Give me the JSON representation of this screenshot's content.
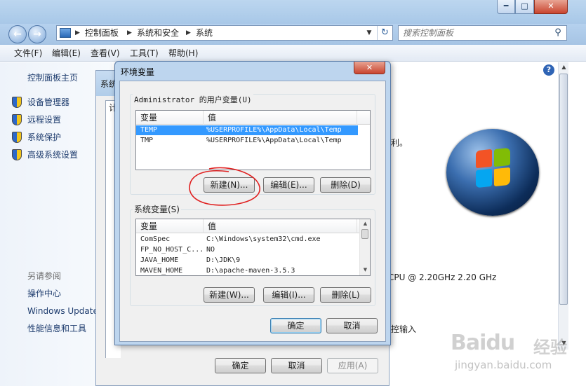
{
  "explorer": {
    "breadcrumbs": [
      "控制面板",
      "系统和安全",
      "系统"
    ],
    "search_placeholder": "搜索控制面板",
    "menu": [
      "文件(F)",
      "编辑(E)",
      "查看(V)",
      "工具(T)",
      "帮助(H)"
    ],
    "sidebar": {
      "home": "控制面板主页",
      "items": [
        "设备管理器",
        "远程设置",
        "系统保护",
        "高级系统设置"
      ],
      "see_also_heading": "另请参阅",
      "see_also": [
        "操作中心",
        "Windows Update",
        "性能信息和工具"
      ]
    },
    "right_fragments": {
      "rights": "利。",
      "cpu": "CPU @ 2.20GHz   2.20 GHz",
      "touch": "控输入"
    }
  },
  "system_properties": {
    "title_fragment": "系统",
    "tab_fragment": "计",
    "ok": "确定",
    "cancel": "取消",
    "apply": "应用(A)"
  },
  "env_dialog": {
    "title": "环境变量",
    "user_group_label": "Administrator 的用户变量(U)",
    "columns": [
      "变量",
      "值"
    ],
    "user_vars": [
      {
        "name": "TEMP",
        "value": "%USERPROFILE%\\AppData\\Local\\Temp",
        "selected": true
      },
      {
        "name": "TMP",
        "value": "%USERPROFILE%\\AppData\\Local\\Temp",
        "selected": false
      }
    ],
    "user_buttons": [
      "新建(N)...",
      "编辑(E)...",
      "删除(D)"
    ],
    "sys_group_label": "系统变量(S)",
    "sys_vars": [
      {
        "name": "ComSpec",
        "value": "C:\\Windows\\system32\\cmd.exe"
      },
      {
        "name": "FP_NO_HOST_C...",
        "value": "NO"
      },
      {
        "name": "JAVA_HOME",
        "value": "D:\\JDK\\9"
      },
      {
        "name": "MAVEN_HOME",
        "value": "D:\\apache-maven-3.5.3"
      }
    ],
    "sys_buttons": [
      "新建(W)...",
      "编辑(I)...",
      "删除(L)"
    ],
    "ok": "确定",
    "cancel": "取消"
  },
  "watermark": {
    "brand": "Baidu",
    "tag": "经验",
    "url": "jingyan.baidu.com"
  }
}
